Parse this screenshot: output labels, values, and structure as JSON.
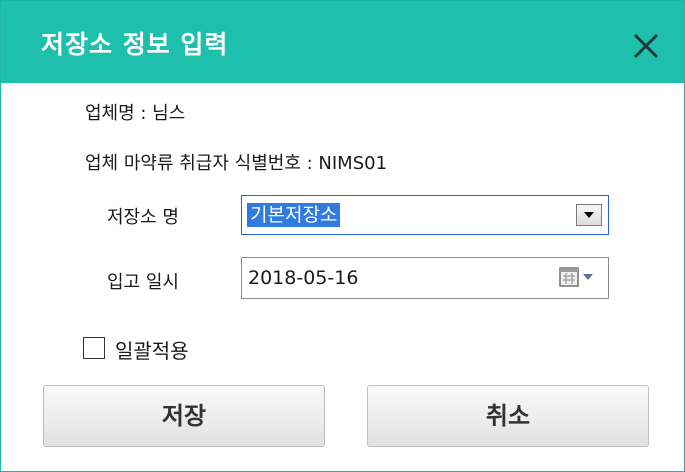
{
  "dialog": {
    "title": "저장소 정보 입력",
    "accent_color": "#1fbfae"
  },
  "info": {
    "company_line": "업체명 : 님스",
    "license_line": "업체 마약류 취급자 식별번호 : NIMS01"
  },
  "form": {
    "storage_label": "저장소 명",
    "storage_value": "기본저장소",
    "date_label": "입고 일시",
    "date_value": "2018-05-16",
    "apply_all_label": "일괄적용",
    "apply_all_checked": false
  },
  "buttons": {
    "save_label": "저장",
    "cancel_label": "취소"
  },
  "icons": {
    "close": "close-icon",
    "dropdown": "chevron-down-icon",
    "calendar": "calendar-icon"
  }
}
